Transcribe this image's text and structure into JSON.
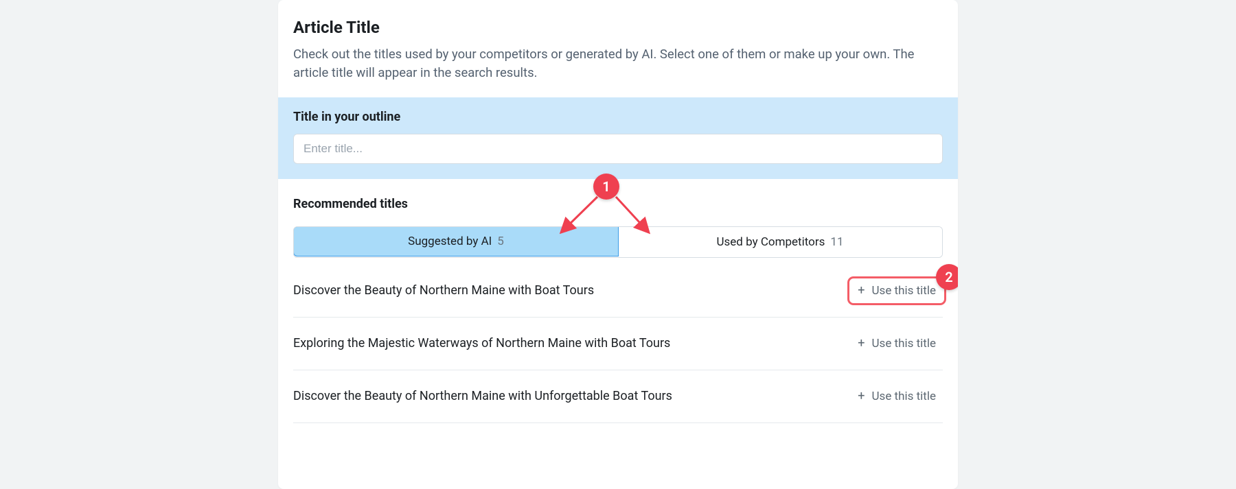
{
  "header": {
    "title": "Article Title",
    "description": "Check out the titles used by your competitors or generated by AI. Select one of them or make up your own. The article title will appear in the search results."
  },
  "outline": {
    "label": "Title in your outline",
    "placeholder": "Enter title..."
  },
  "recommended": {
    "heading": "Recommended titles",
    "tabs": [
      {
        "label": "Suggested by AI",
        "count": "5",
        "active": true
      },
      {
        "label": "Used by Competitors",
        "count": "11",
        "active": false
      }
    ],
    "use_label": "Use this title",
    "items": [
      "Discover the Beauty of Northern Maine with Boat Tours",
      "Exploring the Majestic Waterways of Northern Maine with Boat Tours",
      "Discover the Beauty of Northern Maine with Unforgettable Boat Tours"
    ]
  },
  "annotations": {
    "badge1": "1",
    "badge2": "2",
    "colors": {
      "badge": "#ef4050",
      "highlight": "#f45d67",
      "tab_active_bg": "#a9dbf9"
    }
  }
}
